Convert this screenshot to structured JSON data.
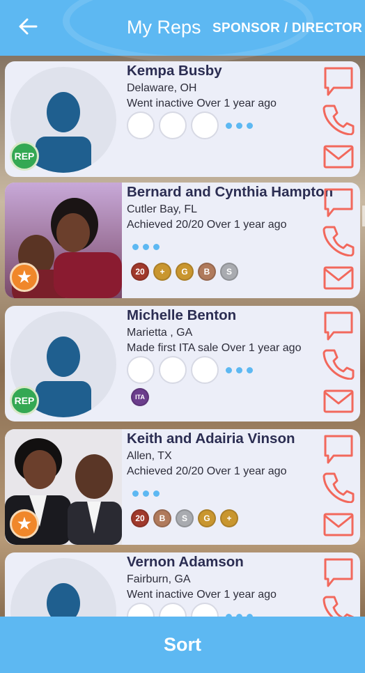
{
  "header": {
    "back_icon": "arrow-left-icon",
    "title": "My Reps",
    "mode": "SPONSOR / DIRECTOR"
  },
  "reps": [
    {
      "name": "Kempa Busby",
      "location": "Delaware, OH",
      "status": "Went inactive Over 1 year ago",
      "badge": "REP",
      "has_photo": false,
      "show_circles": true,
      "awards": []
    },
    {
      "name": "Bernard and Cynthia Hampton",
      "location": "Cutler Bay, FL",
      "status": "Achieved 20/20 Over 1 year ago",
      "badge": "★",
      "has_photo": true,
      "show_circles": false,
      "awards": [
        {
          "label": "20",
          "color": "#a0392c"
        },
        {
          "label": "+",
          "color": "#c9962f"
        },
        {
          "label": "G",
          "color": "#c9962f"
        },
        {
          "label": "B",
          "color": "#b07a5c"
        },
        {
          "label": "S",
          "color": "#a9abb0"
        }
      ]
    },
    {
      "name": "Michelle Benton",
      "location": "Marietta , GA",
      "status": "Made first ITA sale Over 1 year ago",
      "badge": "REP",
      "has_photo": false,
      "show_circles": true,
      "awards": [
        {
          "label": "ITA",
          "color": "#6b3d8c"
        }
      ]
    },
    {
      "name": "Keith and Adairia Vinson",
      "location": "Allen, TX",
      "status": "Achieved 20/20 Over 1 year ago",
      "badge": "★",
      "has_photo": true,
      "show_circles": false,
      "awards": [
        {
          "label": "20",
          "color": "#a0392c"
        },
        {
          "label": "B",
          "color": "#b07a5c"
        },
        {
          "label": "S",
          "color": "#a9abb0"
        },
        {
          "label": "G",
          "color": "#c9962f"
        },
        {
          "label": "+",
          "color": "#c9962f"
        }
      ]
    },
    {
      "name": "Vernon Adamson",
      "location": "Fairburn, GA",
      "status": "Went inactive Over 1 year ago",
      "badge": "",
      "has_photo": false,
      "show_circles": true,
      "awards": []
    }
  ],
  "actions": {
    "message_icon": "message-icon",
    "phone_icon": "phone-icon",
    "email_icon": "email-icon"
  },
  "colors": {
    "accent": "#5db8f2",
    "action_red": "#f2685c",
    "name_color": "#2b2d52"
  },
  "footer": {
    "sort_label": "Sort"
  }
}
